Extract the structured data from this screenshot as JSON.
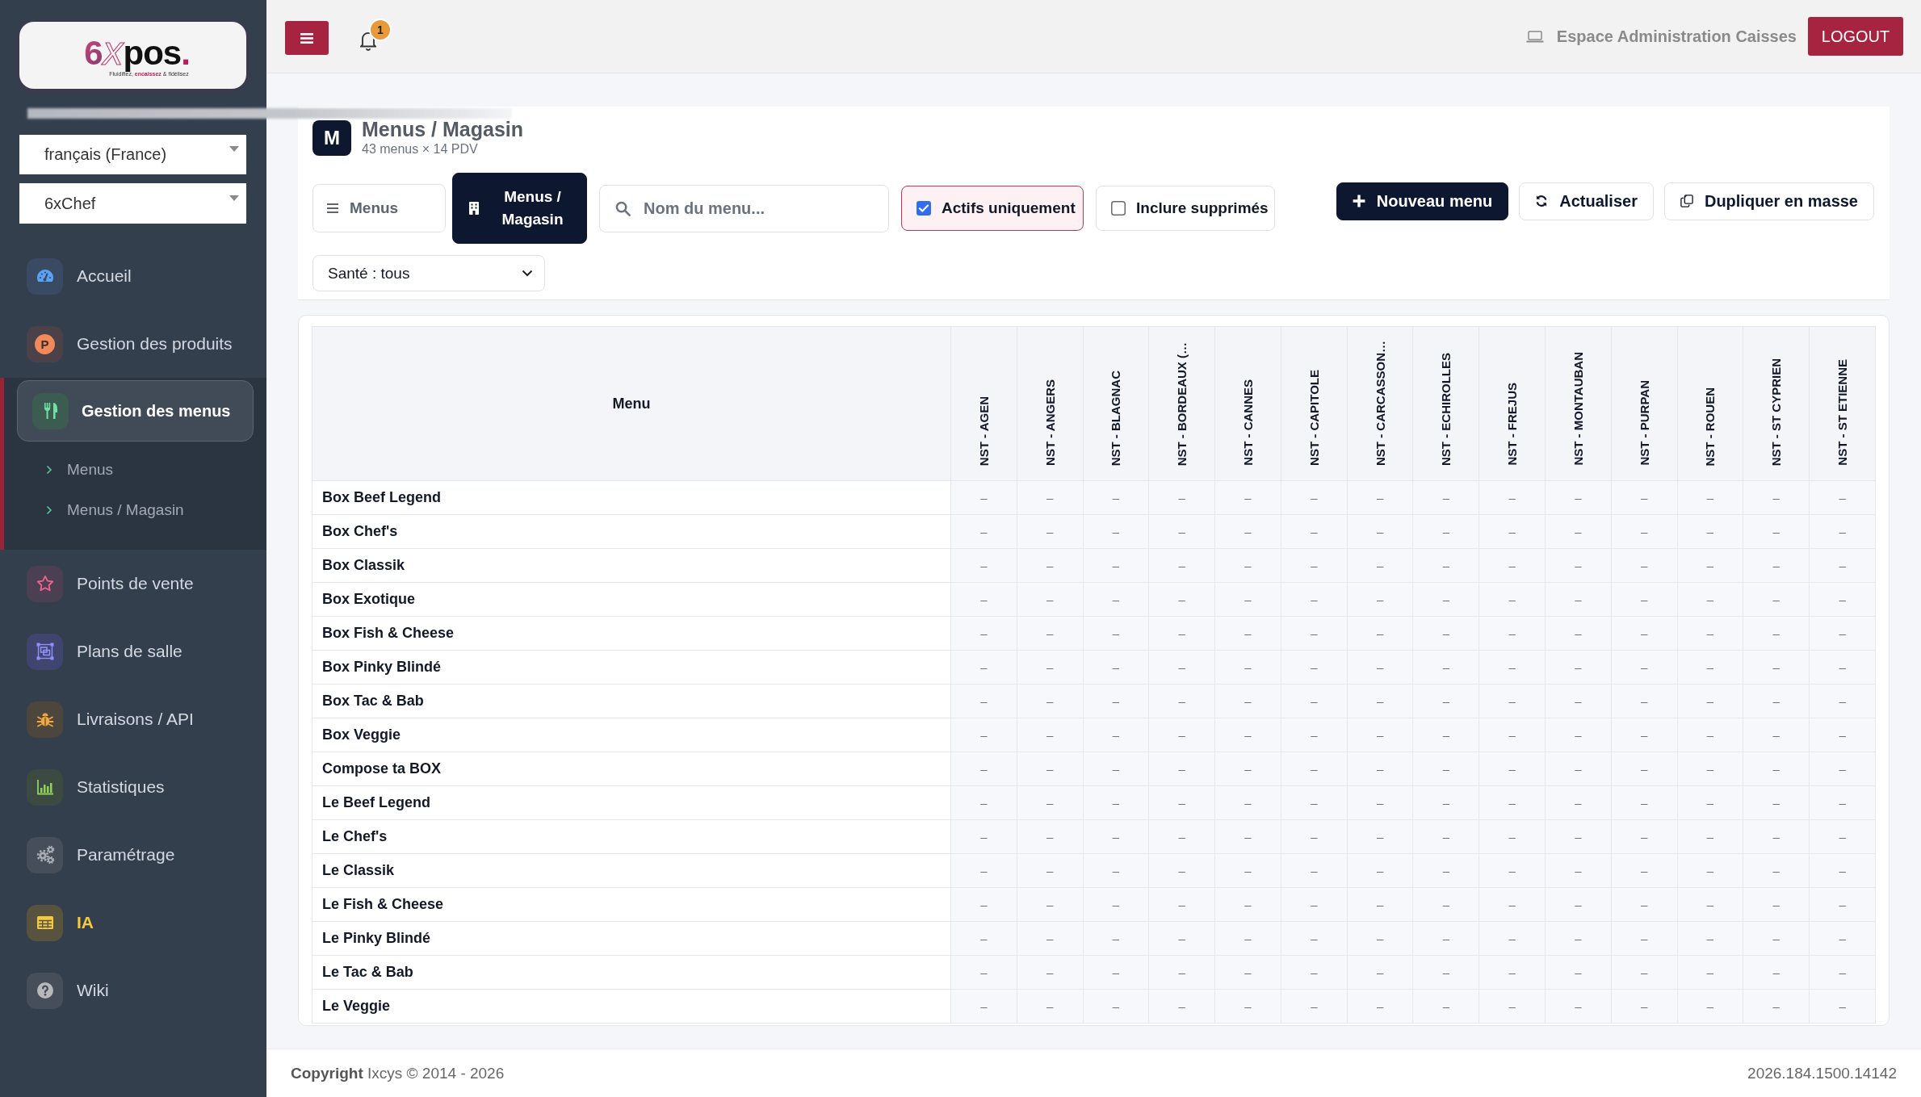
{
  "sidebar": {
    "logo": {
      "wordmark": [
        {
          "text": "6",
          "kind": "gradient"
        },
        {
          "text": "x",
          "kind": "outline"
        },
        {
          "text": "pos",
          "kind": "plain"
        },
        {
          "text": ".",
          "kind": "accent"
        }
      ],
      "tagline": "Fluidifiez, **encaissez** & fidélisez"
    },
    "language_select": {
      "value": "français (France)"
    },
    "store_select": {
      "value": "6xChef"
    },
    "nav_items": [
      {
        "label": "Accueil",
        "selected": false,
        "highlighted": false
      },
      {
        "label": "Gestion des produits",
        "selected": false,
        "highlighted": false,
        "icon_letter": "P"
      },
      {
        "label": "Gestion des menus",
        "selected": true,
        "highlighted": false,
        "expanded": true,
        "children": [
          {
            "label": "Menus",
            "selected": false
          },
          {
            "label": "Menus / Magasin",
            "selected": false
          }
        ]
      },
      {
        "label": "Points de vente",
        "selected": false,
        "highlighted": false
      },
      {
        "label": "Plans de salle",
        "selected": false,
        "highlighted": false
      },
      {
        "label": "Livraisons / API",
        "selected": false,
        "highlighted": false
      },
      {
        "label": "Statistiques",
        "selected": false,
        "highlighted": false
      },
      {
        "label": "Paramétrage",
        "selected": false,
        "highlighted": false
      },
      {
        "label": "IA",
        "selected": false,
        "highlighted": true
      },
      {
        "label": "Wiki",
        "selected": false,
        "highlighted": false
      }
    ]
  },
  "topbar": {
    "notification_count": "1",
    "workspace_label": "Espace Administration Caisses",
    "logout_button": "LOGOUT"
  },
  "page_header": {
    "initial": "M",
    "title": "Menus / Magasin",
    "subtitle": "43 menus × 14 PDV"
  },
  "toolbar": {
    "view_tabs": [
      {
        "label": "Menus",
        "selected": false
      },
      {
        "label": "Menus / Magasin",
        "selected": true
      }
    ],
    "search": {
      "placeholder": "Nom du menu..."
    },
    "filters": [
      {
        "label": "Actifs uniquement",
        "checked": true
      },
      {
        "label": "Inclure supprimés",
        "checked": false
      }
    ],
    "actions": [
      {
        "label": "Nouveau menu",
        "kind": "primary"
      },
      {
        "label": "Actualiser",
        "kind": "secondary"
      },
      {
        "label": "Dupliquer en masse",
        "kind": "secondary"
      }
    ],
    "health_select": {
      "value": "Santé : tous"
    }
  },
  "table": {
    "columns": [
      "Menu",
      "NST - AGEN",
      "NST - ANGERS",
      "NST - BLAGNAC",
      "NST - BORDEAUX (…",
      "NST - CANNES",
      "NST - CAPITOLE",
      "NST - CARCASSON…",
      "NST - ECHIROLLES",
      "NST - FREJUS",
      "NST - MONTAUBAN",
      "NST - PURPAN",
      "NST - ROUEN",
      "NST - ST CYPRIEN",
      "NST - ST ETIENNE"
    ],
    "rows": [
      {
        "cells": [
          "Box Beef Legend",
          "–",
          "–",
          "–",
          "–",
          "–",
          "–",
          "–",
          "–",
          "–",
          "–",
          "–",
          "–",
          "–",
          "–"
        ]
      },
      {
        "cells": [
          "Box Chef's",
          "–",
          "–",
          "–",
          "–",
          "–",
          "–",
          "–",
          "–",
          "–",
          "–",
          "–",
          "–",
          "–",
          "–"
        ]
      },
      {
        "cells": [
          "Box Classik",
          "–",
          "–",
          "–",
          "–",
          "–",
          "–",
          "–",
          "–",
          "–",
          "–",
          "–",
          "–",
          "–",
          "–"
        ]
      },
      {
        "cells": [
          "Box Exotique",
          "–",
          "–",
          "–",
          "–",
          "–",
          "–",
          "–",
          "–",
          "–",
          "–",
          "–",
          "–",
          "–",
          "–"
        ]
      },
      {
        "cells": [
          "Box Fish & Cheese",
          "–",
          "–",
          "–",
          "–",
          "–",
          "–",
          "–",
          "–",
          "–",
          "–",
          "–",
          "–",
          "–",
          "–"
        ]
      },
      {
        "cells": [
          "Box Pinky Blindé",
          "–",
          "–",
          "–",
          "–",
          "–",
          "–",
          "–",
          "–",
          "–",
          "–",
          "–",
          "–",
          "–",
          "–"
        ]
      },
      {
        "cells": [
          "Box Tac & Bab",
          "–",
          "–",
          "–",
          "–",
          "–",
          "–",
          "–",
          "–",
          "–",
          "–",
          "–",
          "–",
          "–",
          "–"
        ]
      },
      {
        "cells": [
          "Box Veggie",
          "–",
          "–",
          "–",
          "–",
          "–",
          "–",
          "–",
          "–",
          "–",
          "–",
          "–",
          "–",
          "–",
          "–"
        ]
      },
      {
        "cells": [
          "Compose ta BOX",
          "–",
          "–",
          "–",
          "–",
          "–",
          "–",
          "–",
          "–",
          "–",
          "–",
          "–",
          "–",
          "–",
          "–"
        ]
      },
      {
        "cells": [
          "Le Beef Legend",
          "–",
          "–",
          "–",
          "–",
          "–",
          "–",
          "–",
          "–",
          "–",
          "–",
          "–",
          "–",
          "–",
          "–"
        ]
      },
      {
        "cells": [
          "Le Chef's",
          "–",
          "–",
          "–",
          "–",
          "–",
          "–",
          "–",
          "–",
          "–",
          "–",
          "–",
          "–",
          "–",
          "–"
        ]
      },
      {
        "cells": [
          "Le Classik",
          "–",
          "–",
          "–",
          "–",
          "–",
          "–",
          "–",
          "–",
          "–",
          "–",
          "–",
          "–",
          "–",
          "–"
        ]
      },
      {
        "cells": [
          "Le Fish & Cheese",
          "–",
          "–",
          "–",
          "–",
          "–",
          "–",
          "–",
          "–",
          "–",
          "–",
          "–",
          "–",
          "–",
          "–"
        ]
      },
      {
        "cells": [
          "Le Pinky Blindé",
          "–",
          "–",
          "–",
          "–",
          "–",
          "–",
          "–",
          "–",
          "–",
          "–",
          "–",
          "–",
          "–",
          "–"
        ]
      },
      {
        "cells": [
          "Le Tac & Bab",
          "–",
          "–",
          "–",
          "–",
          "–",
          "–",
          "–",
          "–",
          "–",
          "–",
          "–",
          "–",
          "–",
          "–"
        ]
      },
      {
        "cells": [
          "Le Veggie",
          "–",
          "–",
          "–",
          "–",
          "–",
          "–",
          "–",
          "–",
          "–",
          "–",
          "–",
          "–",
          "–",
          "–"
        ]
      }
    ]
  },
  "footer": {
    "copyright": "**Copyright** Ixcys © 2014 - 2026",
    "version": "2026.184.1500.14142"
  }
}
